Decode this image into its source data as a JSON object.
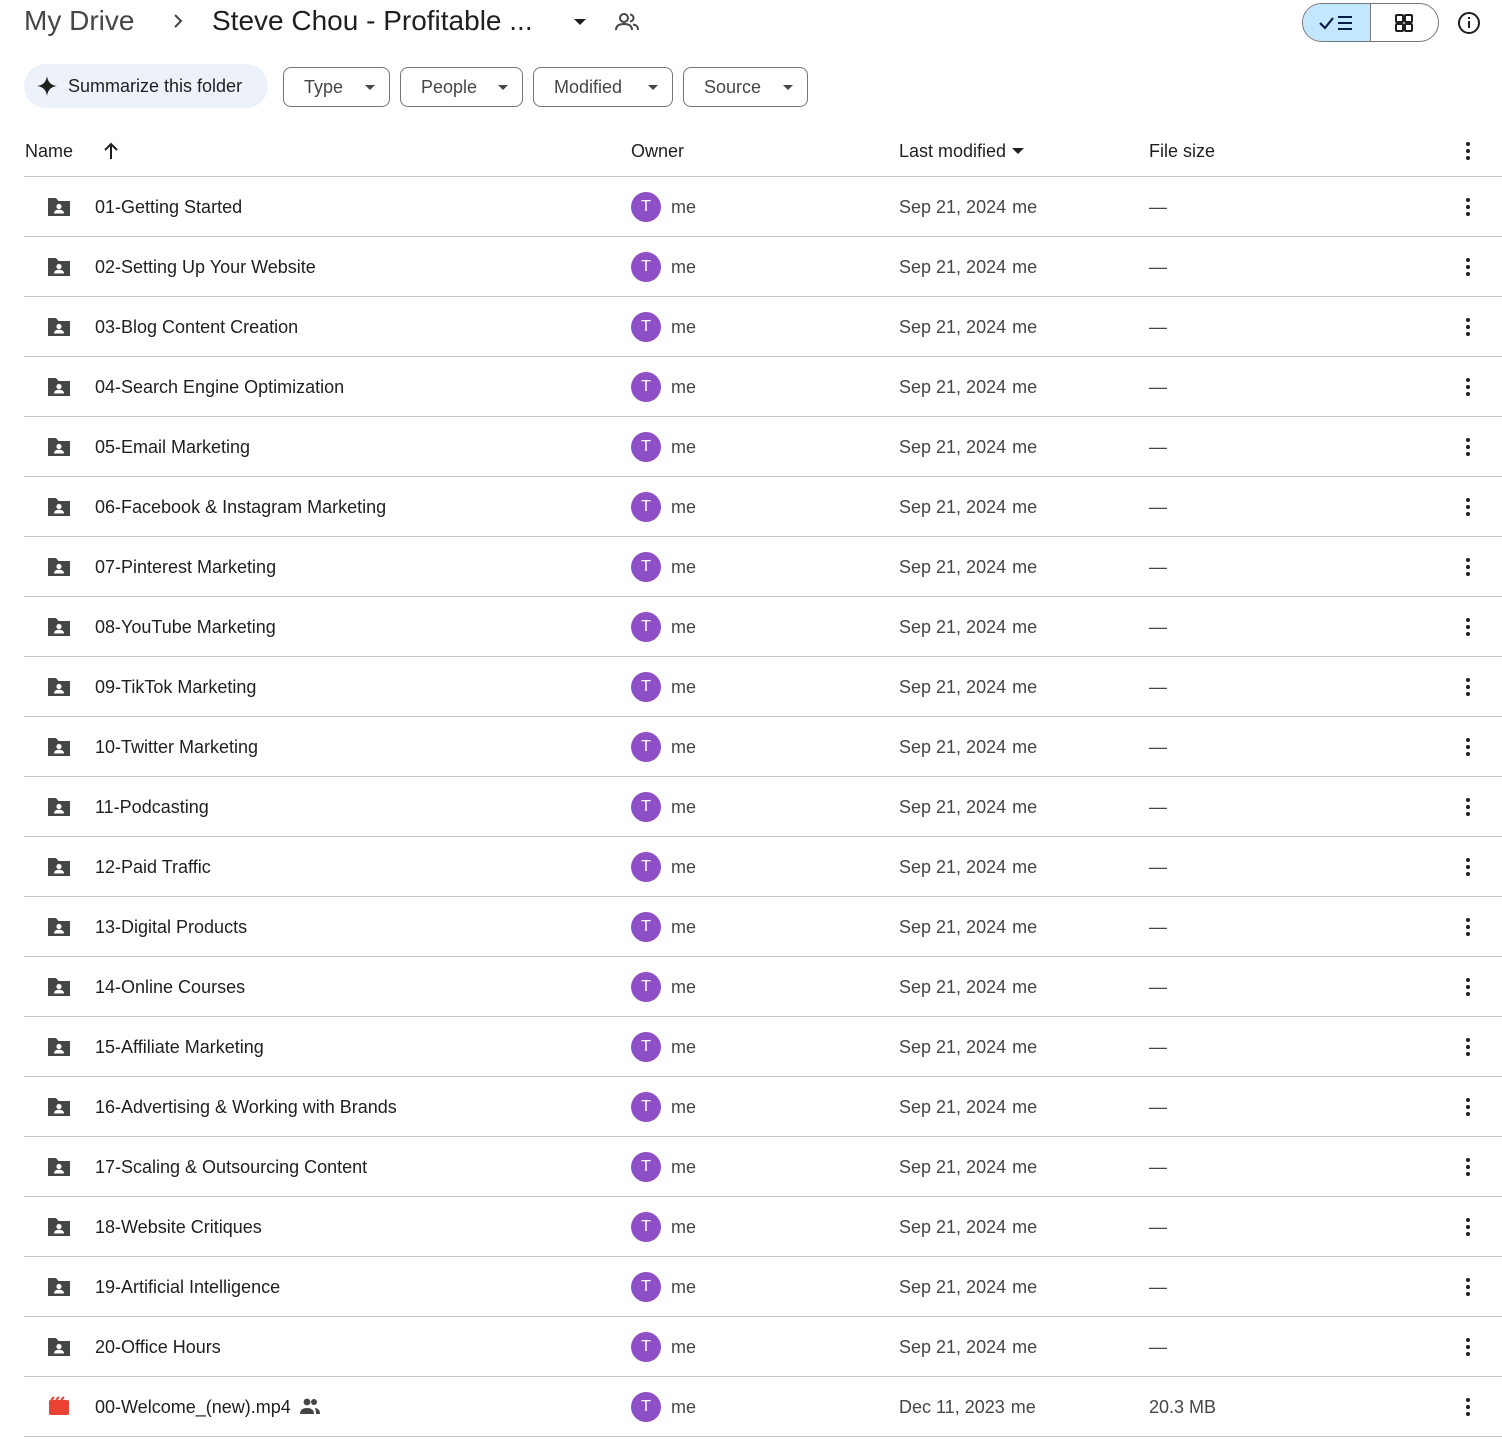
{
  "breadcrumb": {
    "root": "My Drive",
    "current": "Steve Chou - Profitable ..."
  },
  "filters": {
    "summarize": "Summarize this folder",
    "type": "Type",
    "people": "People",
    "modified": "Modified",
    "source": "Source"
  },
  "columns": {
    "name": "Name",
    "owner": "Owner",
    "last_modified": "Last modified",
    "file_size": "File size"
  },
  "colors": {
    "avatar": "#8e4ec6",
    "video_icon": "#ea4335",
    "toggle_active": "#c2e7ff",
    "chip_bg": "#edf2fa"
  },
  "rows": [
    {
      "name": "01-Getting Started",
      "icon": "shared-folder-icon",
      "avatar": "T",
      "owner": "me",
      "modified": "Sep 21, 2024",
      "modified_by": "me",
      "size": "—"
    },
    {
      "name": "02-Setting Up Your Website",
      "icon": "shared-folder-icon",
      "avatar": "T",
      "owner": "me",
      "modified": "Sep 21, 2024",
      "modified_by": "me",
      "size": "—"
    },
    {
      "name": "03-Blog Content Creation",
      "icon": "shared-folder-icon",
      "avatar": "T",
      "owner": "me",
      "modified": "Sep 21, 2024",
      "modified_by": "me",
      "size": "—"
    },
    {
      "name": "04-Search Engine Optimization",
      "icon": "shared-folder-icon",
      "avatar": "T",
      "owner": "me",
      "modified": "Sep 21, 2024",
      "modified_by": "me",
      "size": "—"
    },
    {
      "name": "05-Email Marketing",
      "icon": "shared-folder-icon",
      "avatar": "T",
      "owner": "me",
      "modified": "Sep 21, 2024",
      "modified_by": "me",
      "size": "—"
    },
    {
      "name": "06-Facebook & Instagram Marketing",
      "icon": "shared-folder-icon",
      "avatar": "T",
      "owner": "me",
      "modified": "Sep 21, 2024",
      "modified_by": "me",
      "size": "—"
    },
    {
      "name": "07-Pinterest Marketing",
      "icon": "shared-folder-icon",
      "avatar": "T",
      "owner": "me",
      "modified": "Sep 21, 2024",
      "modified_by": "me",
      "size": "—"
    },
    {
      "name": "08-YouTube Marketing",
      "icon": "shared-folder-icon",
      "avatar": "T",
      "owner": "me",
      "modified": "Sep 21, 2024",
      "modified_by": "me",
      "size": "—"
    },
    {
      "name": "09-TikTok Marketing",
      "icon": "shared-folder-icon",
      "avatar": "T",
      "owner": "me",
      "modified": "Sep 21, 2024",
      "modified_by": "me",
      "size": "—"
    },
    {
      "name": "10-Twitter Marketing",
      "icon": "shared-folder-icon",
      "avatar": "T",
      "owner": "me",
      "modified": "Sep 21, 2024",
      "modified_by": "me",
      "size": "—"
    },
    {
      "name": "11-Podcasting",
      "icon": "shared-folder-icon",
      "avatar": "T",
      "owner": "me",
      "modified": "Sep 21, 2024",
      "modified_by": "me",
      "size": "—"
    },
    {
      "name": "12-Paid Traffic",
      "icon": "shared-folder-icon",
      "avatar": "T",
      "owner": "me",
      "modified": "Sep 21, 2024",
      "modified_by": "me",
      "size": "—"
    },
    {
      "name": "13-Digital Products",
      "icon": "shared-folder-icon",
      "avatar": "T",
      "owner": "me",
      "modified": "Sep 21, 2024",
      "modified_by": "me",
      "size": "—"
    },
    {
      "name": "14-Online Courses",
      "icon": "shared-folder-icon",
      "avatar": "T",
      "owner": "me",
      "modified": "Sep 21, 2024",
      "modified_by": "me",
      "size": "—"
    },
    {
      "name": "15-Affiliate Marketing",
      "icon": "shared-folder-icon",
      "avatar": "T",
      "owner": "me",
      "modified": "Sep 21, 2024",
      "modified_by": "me",
      "size": "—"
    },
    {
      "name": "16-Advertising & Working with Brands",
      "icon": "shared-folder-icon",
      "avatar": "T",
      "owner": "me",
      "modified": "Sep 21, 2024",
      "modified_by": "me",
      "size": "—"
    },
    {
      "name": "17-Scaling & Outsourcing Content",
      "icon": "shared-folder-icon",
      "avatar": "T",
      "owner": "me",
      "modified": "Sep 21, 2024",
      "modified_by": "me",
      "size": "—"
    },
    {
      "name": "18-Website Critiques",
      "icon": "shared-folder-icon",
      "avatar": "T",
      "owner": "me",
      "modified": "Sep 21, 2024",
      "modified_by": "me",
      "size": "—"
    },
    {
      "name": "19-Artificial Intelligence",
      "icon": "shared-folder-icon",
      "avatar": "T",
      "owner": "me",
      "modified": "Sep 21, 2024",
      "modified_by": "me",
      "size": "—"
    },
    {
      "name": "20-Office Hours",
      "icon": "shared-folder-icon",
      "avatar": "T",
      "owner": "me",
      "modified": "Sep 21, 2024",
      "modified_by": "me",
      "size": "—"
    },
    {
      "name": "00-Welcome_(new).mp4",
      "icon": "video-file-icon",
      "shared": true,
      "avatar": "T",
      "owner": "me",
      "modified": "Dec 11, 2023",
      "modified_by": "me",
      "size": "20.3 MB"
    }
  ]
}
